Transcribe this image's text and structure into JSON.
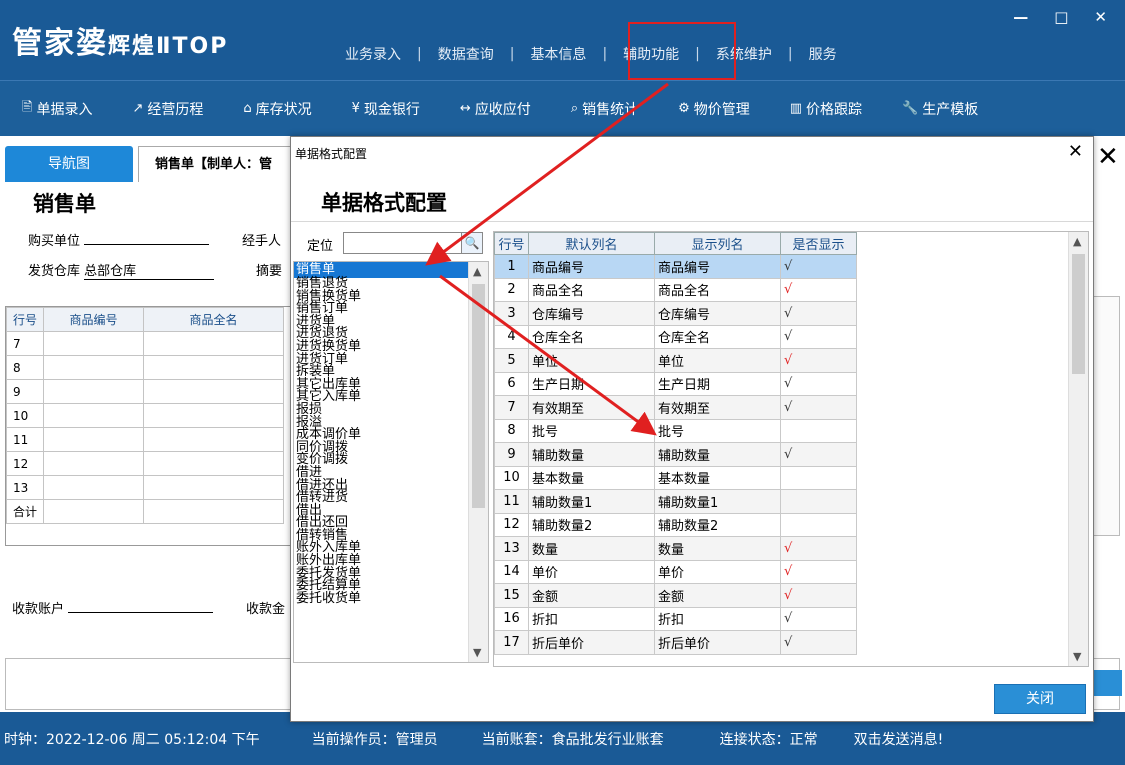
{
  "app": {
    "logo_text": "管家婆",
    "logo_sub": "辉煌ⅡTOP",
    "menu": [
      "业务录入",
      "数据查询",
      "基本信息",
      "辅助功能",
      "系统维护",
      "服务"
    ],
    "window_controls": [
      "—",
      "□",
      "✕"
    ]
  },
  "toolbar": [
    {
      "icon": "doc-entry-icon",
      "glyph": "🖹",
      "label": "单据录入"
    },
    {
      "icon": "history-chart-icon",
      "glyph": "↗",
      "label": "经营历程"
    },
    {
      "icon": "warehouse-icon",
      "glyph": "⌂",
      "label": "库存状况"
    },
    {
      "icon": "yen-icon",
      "glyph": "¥",
      "label": "现金银行"
    },
    {
      "icon": "exchange-icon",
      "glyph": "↔",
      "label": "应收应付"
    },
    {
      "icon": "search-icon",
      "glyph": "⌕",
      "label": "销售统计"
    },
    {
      "icon": "gear-icon",
      "glyph": "⚙",
      "label": "物价管理"
    },
    {
      "icon": "bar-chart-icon",
      "glyph": "▥",
      "label": "价格跟踪"
    },
    {
      "icon": "wrench-icon",
      "glyph": "🔧",
      "label": "生产模板"
    }
  ],
  "background_doc": {
    "tab_nav": "导航图",
    "tab_doc": "销售单【制单人：管",
    "title": "销售单",
    "buyer_label": "购买单位",
    "handler_label": "经手人",
    "warehouse_label": "发货仓库",
    "warehouse_value": "总部仓库",
    "summary_label": "摘要",
    "grid_headers": [
      "行号",
      "商品编号",
      "商品全名"
    ],
    "rows": [
      "7",
      "8",
      "9",
      "10",
      "11",
      "12",
      "13"
    ],
    "total_label": "合计",
    "account_label": "收款账户",
    "amount_label": "收款金"
  },
  "status": {
    "clock": "时钟：2022-12-06 周二 05:12:04 下午",
    "operator": "当前操作员：管理员",
    "account": "当前账套：食品批发行业账套",
    "connection": "连接状态：正常",
    "message": "双击发送消息!"
  },
  "dialog": {
    "caption": "单据格式配置",
    "heading": "单据格式配置",
    "locate_label": "定位",
    "locate_value": "",
    "close_button": "关闭",
    "doc_types": [
      "销售单",
      "销售退货",
      "销售换货单",
      "销售订单",
      "进货单",
      "进货退货",
      "进货换货单",
      "进货订单",
      "拆装单",
      "其它出库单",
      "其它入库单",
      "报损",
      "报溢",
      "成本调价单",
      "同价调拨",
      "变价调拨",
      "借进",
      "借进还出",
      "借转进货",
      "借出",
      "借出还回",
      "借转销售",
      "账外入库单",
      "账外出库单",
      "委托发货单",
      "委托结算单",
      "委托收货单"
    ],
    "grid_headers": [
      "行号",
      "默认列名",
      "显示列名",
      "是否显示"
    ],
    "grid_rows": [
      {
        "n": "1",
        "default": "商品编号",
        "display": "商品编号",
        "show": "√",
        "red": false
      },
      {
        "n": "2",
        "default": "商品全名",
        "display": "商品全名",
        "show": "√",
        "red": true
      },
      {
        "n": "3",
        "default": "仓库编号",
        "display": "仓库编号",
        "show": "√",
        "red": false
      },
      {
        "n": "4",
        "default": "仓库全名",
        "display": "仓库全名",
        "show": "√",
        "red": false
      },
      {
        "n": "5",
        "default": "单位",
        "display": "单位",
        "show": "√",
        "red": true
      },
      {
        "n": "6",
        "default": "生产日期",
        "display": "生产日期",
        "show": "√",
        "red": false
      },
      {
        "n": "7",
        "default": "有效期至",
        "display": "有效期至",
        "show": "√",
        "red": false
      },
      {
        "n": "8",
        "default": "批号",
        "display": "批号",
        "show": "",
        "red": false
      },
      {
        "n": "9",
        "default": "辅助数量",
        "display": "辅助数量",
        "show": "√",
        "red": false
      },
      {
        "n": "10",
        "default": "基本数量",
        "display": "基本数量",
        "show": "",
        "red": false
      },
      {
        "n": "11",
        "default": "辅助数量1",
        "display": "辅助数量1",
        "show": "",
        "red": false
      },
      {
        "n": "12",
        "default": "辅助数量2",
        "display": "辅助数量2",
        "show": "",
        "red": false
      },
      {
        "n": "13",
        "default": "数量",
        "display": "数量",
        "show": "√",
        "red": true
      },
      {
        "n": "14",
        "default": "单价",
        "display": "单价",
        "show": "√",
        "red": true
      },
      {
        "n": "15",
        "default": "金额",
        "display": "金额",
        "show": "√",
        "red": true
      },
      {
        "n": "16",
        "default": "折扣",
        "display": "折扣",
        "show": "√",
        "red": false
      },
      {
        "n": "17",
        "default": "折后单价",
        "display": "折后单价",
        "show": "√",
        "red": false
      }
    ]
  },
  "colors": {
    "header_blue": "#1a5a96",
    "accent_blue": "#1677d3",
    "highlight_red": "#e02020"
  }
}
